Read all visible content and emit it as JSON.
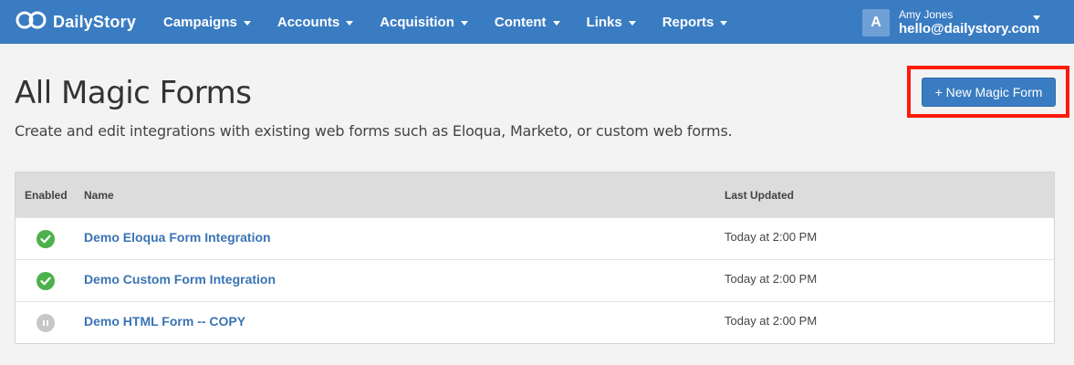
{
  "app": {
    "brand": "DailyStory",
    "nav": [
      "Campaigns",
      "Accounts",
      "Acquisition",
      "Content",
      "Links",
      "Reports"
    ],
    "user": {
      "avatar_letter": "A",
      "name": "Amy Jones",
      "email": "hello@dailystory.com"
    }
  },
  "page": {
    "title": "All Magic Forms",
    "description": "Create and edit integrations with existing web forms such as Eloqua, Marketo, or custom web forms.",
    "new_button": "+ New Magic Form"
  },
  "table": {
    "headers": {
      "enabled": "Enabled",
      "name": "Name",
      "last_updated": "Last Updated"
    },
    "rows": [
      {
        "status": "enabled",
        "status_icon": "check-circle-icon",
        "name": "Demo Eloqua Form Integration",
        "updated": "Today at 2:00 PM"
      },
      {
        "status": "enabled",
        "status_icon": "check-circle-icon",
        "name": "Demo Custom Form Integration",
        "updated": "Today at 2:00 PM"
      },
      {
        "status": "paused",
        "status_icon": "pause-circle-icon",
        "name": "Demo HTML Form -- COPY",
        "updated": "Today at 2:00 PM"
      }
    ]
  },
  "colors": {
    "primary": "#3a7cc2",
    "enabled": "#4cb14c",
    "paused": "#c7c7c7",
    "highlight": "#ff1a0a",
    "link": "#3a73b4"
  }
}
